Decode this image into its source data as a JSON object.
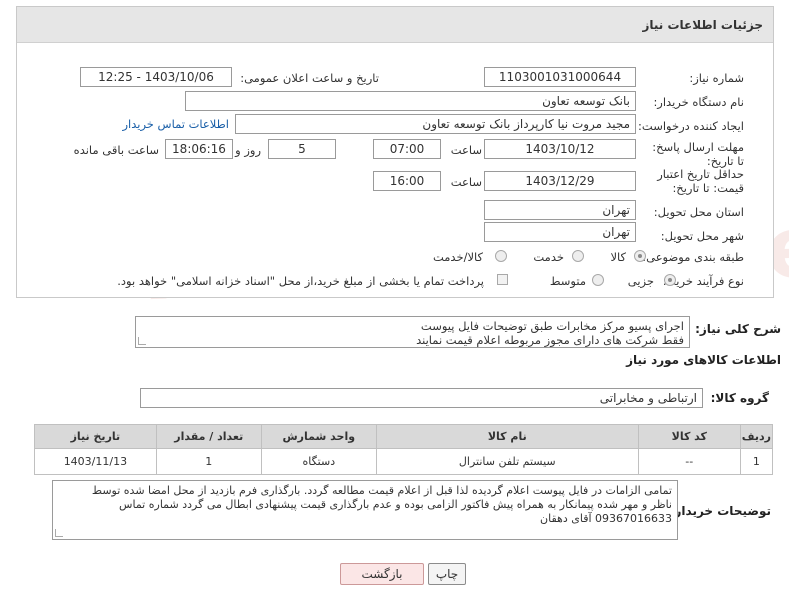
{
  "panel": {
    "title": "جزئیات اطلاعات نیاز"
  },
  "fields": {
    "need_number_label": "شماره نیاز:",
    "need_number": "1103001031000644",
    "announce_label": "تاریخ و ساعت اعلان عمومی:",
    "announce_value": "1403/10/06 - 12:25",
    "buyer_org_label": "نام دستگاه خریدار:",
    "buyer_org": "بانک توسعه تعاون",
    "creator_label": "ایجاد کننده درخواست:",
    "creator": "مجید مروت نیا کارپرداز بانک توسعه تعاون",
    "contact_link": "اطلاعات تماس خریدار",
    "deadline_label": "مهلت ارسال پاسخ: تا تاریخ:",
    "deadline_date": "1403/10/12",
    "time_label": "ساعت",
    "deadline_time": "07:00",
    "days_value": "5",
    "days_label": "روز و",
    "remaining_time": "18:06:16",
    "remaining_label": "ساعت باقی مانده",
    "validity_label": "حداقل تاریخ اعتبار قیمت: تا تاریخ:",
    "validity_date": "1403/12/29",
    "validity_time": "16:00",
    "province_label": "استان محل تحویل:",
    "province": "تهران",
    "city_label": "شهر محل تحویل:",
    "city": "تهران",
    "category_label": "طبقه بندی موضوعی:",
    "category_options": [
      "کالا",
      "خدمت",
      "کالا/خدمت"
    ],
    "process_label": "نوع فرآیند خرید :",
    "process_options": [
      "جزیی",
      "متوسط"
    ],
    "payment_note": "پرداخت تمام یا بخشی از مبلغ خرید،از محل \"اسناد خزانه اسلامی\" خواهد بود."
  },
  "description": {
    "label": "شرح کلی نیاز:",
    "lines": [
      "اجرای پسیو مرکز مخابرات طبق توضیحات فایل پیوست",
      "فقط شرکت های دارای مجوز مربوطه اعلام قیمت نمایند"
    ]
  },
  "goods_info_title": "اطلاعات کالاهای مورد نیاز",
  "goods_group": {
    "label": "گروه کالا:",
    "value": "ارتباطی و مخابراتی"
  },
  "table": {
    "headers": [
      "ردیف",
      "کد کالا",
      "نام کالا",
      "واحد شمارش",
      "تعداد / مقدار",
      "تاریخ نیاز"
    ],
    "rows": [
      [
        "1",
        "--",
        "سیستم تلفن سانترال",
        "دستگاه",
        "1",
        "1403/11/13"
      ]
    ]
  },
  "buyer_notes": {
    "label": "توضیحات خریدار:",
    "lines": [
      "تمامی الزامات در فایل پیوست اعلام گردیده لذا قبل از اعلام قیمت مطالعه گردد. بارگذاری فرم بازدید از محل امضا شده توسط",
      "ناظر و مهر شده پیمانکار به همراه پیش فاکتور الزامی بوده و عدم بارگذاری قیمت پیشنهادی ابطال می گردد شماره تماس",
      "09367016633  آقای دهقان"
    ]
  },
  "buttons": {
    "print": "چاپ",
    "back": "بازگشت"
  },
  "watermark": "AriaTender.net"
}
